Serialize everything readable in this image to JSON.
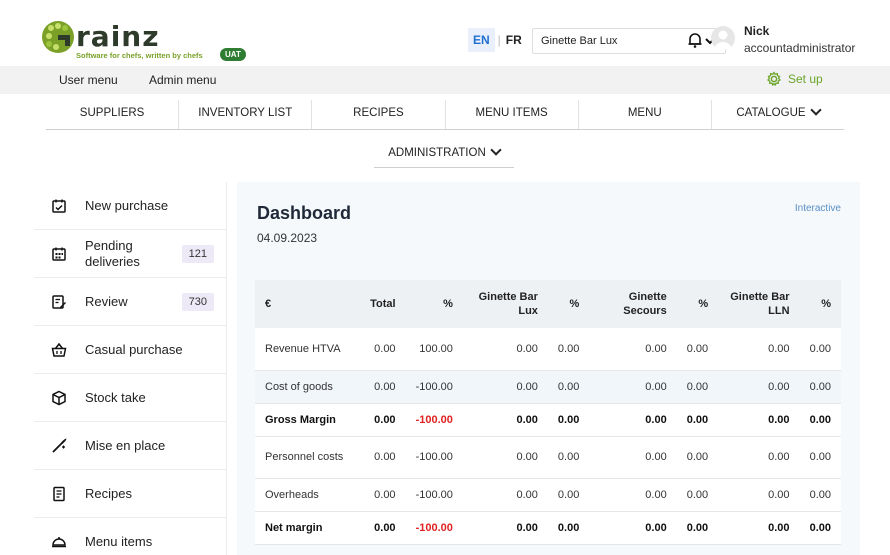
{
  "header": {
    "logo_word": "rainz",
    "logo_tagline": "Software for chefs, written by chefs",
    "env_badge": "UAT",
    "lang_en": "EN",
    "lang_fr": "FR",
    "venue_selected": "Ginette Bar Lux",
    "user_name": "Nick",
    "user_role": "accountadministrator"
  },
  "subbar": {
    "user_menu": "User menu",
    "admin_menu": "Admin menu",
    "setup": "Set up"
  },
  "nav": {
    "items": [
      "SUPPLIERS",
      "INVENTORY LIST",
      "RECIPES",
      "MENU ITEMS",
      "MENU",
      "CATALOGUE"
    ],
    "administration": "ADMINISTRATION"
  },
  "sidebar": {
    "items": [
      {
        "label": "New purchase",
        "count": "",
        "icon": "calendar-plus-icon"
      },
      {
        "label": "Pending deliveries",
        "count": "121",
        "icon": "calendar-grid-icon"
      },
      {
        "label": "Review",
        "count": "730",
        "icon": "edit-note-icon"
      },
      {
        "label": "Casual purchase",
        "count": "",
        "icon": "basket-icon"
      },
      {
        "label": "Stock take",
        "count": "",
        "icon": "package-icon"
      },
      {
        "label": "Mise en place",
        "count": "",
        "icon": "whisk-icon"
      },
      {
        "label": "Recipes",
        "count": "",
        "icon": "recipe-book-icon"
      },
      {
        "label": "Menu items",
        "count": "",
        "icon": "cloche-icon"
      }
    ]
  },
  "dashboard": {
    "title": "Dashboard",
    "date": "04.09.2023",
    "mode": "Interactive",
    "columns": [
      "€",
      "Total",
      "%",
      "Ginette Bar Lux",
      "%",
      "Ginette Secours",
      "%",
      "Ginette Bar LLN",
      "%"
    ],
    "rows": [
      {
        "label": "Revenue HTVA",
        "values": [
          "0.00",
          "100.00",
          "0.00",
          "0.00",
          "0.00",
          "0.00",
          "0.00",
          "0.00"
        ],
        "bold": false
      },
      {
        "label": "Cost of goods",
        "values": [
          "0.00",
          "-100.00",
          "0.00",
          "0.00",
          "0.00",
          "0.00",
          "0.00",
          "0.00"
        ],
        "bold": false
      },
      {
        "label": "Gross Margin",
        "values": [
          "0.00",
          "-100.00",
          "0.00",
          "0.00",
          "0.00",
          "0.00",
          "0.00",
          "0.00"
        ],
        "bold": true
      },
      {
        "label": "Personnel costs",
        "values": [
          "0.00",
          "-100.00",
          "0.00",
          "0.00",
          "0.00",
          "0.00",
          "0.00",
          "0.00"
        ],
        "bold": false
      },
      {
        "label": "Overheads",
        "values": [
          "0.00",
          "-100.00",
          "0.00",
          "0.00",
          "0.00",
          "0.00",
          "0.00",
          "0.00"
        ],
        "bold": false
      },
      {
        "label": "Net margin",
        "values": [
          "0.00",
          "-100.00",
          "0.00",
          "0.00",
          "0.00",
          "0.00",
          "0.00",
          "0.00"
        ],
        "bold": true
      }
    ]
  },
  "colors": {
    "brand_green": "#6aa52a",
    "negative": "#e02222",
    "accent_blue": "#1f6fd1"
  }
}
